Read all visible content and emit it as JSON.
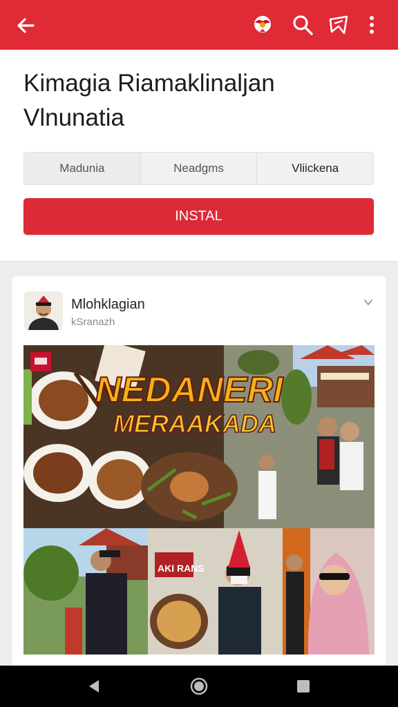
{
  "app_bar": {
    "background": "#e02a36",
    "icons": [
      "back-arrow-icon",
      "emblem-icon",
      "search-icon",
      "share-icon",
      "more-vert-icon"
    ]
  },
  "header": {
    "title_line1": "Kimagia Riamaklinaljan",
    "title_line2": "Vlnunatia",
    "tabs": [
      {
        "label": "Madunia"
      },
      {
        "label": "Neadgms"
      },
      {
        "label": "Vliickena"
      }
    ],
    "install_label": "INSTAL",
    "accent": "#dc2a36"
  },
  "post": {
    "author_name": "Mlohklagian",
    "author_sub": "kSranazh",
    "image": {
      "banner_line1": "NEDANERI",
      "banner_line2": "MERAAKADA",
      "badge_top": " ",
      "sign_text": "AKI RANS"
    }
  },
  "system_nav": {
    "icons": [
      "nav-back-icon",
      "nav-home-icon",
      "nav-recent-icon"
    ]
  }
}
